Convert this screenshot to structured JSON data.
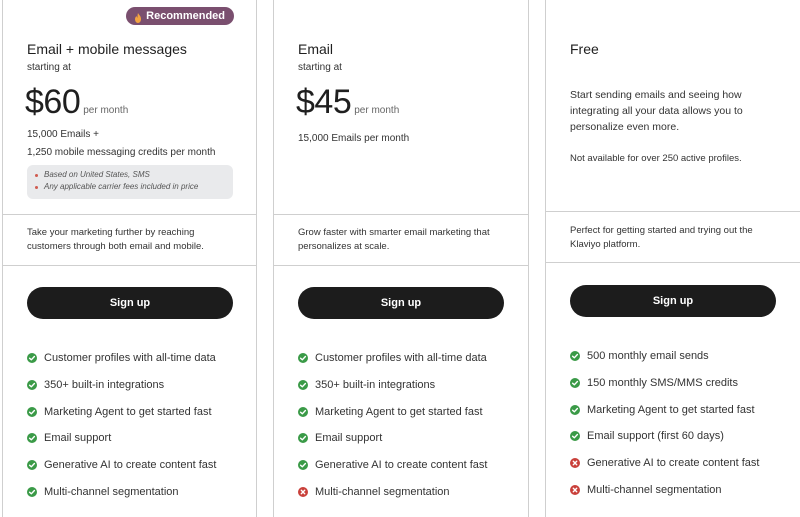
{
  "plans": [
    {
      "badge": "Recommended",
      "name": "Email + mobile messages",
      "starting": "starting at",
      "price": "$60",
      "per": "per month",
      "details": [
        "15,000 Emails +",
        "1,250 mobile messaging credits per month"
      ],
      "notes": [
        "Based on United States, SMS",
        "Any applicable carrier fees included in price"
      ],
      "desc": "Take your marketing further by reaching customers through both email and mobile.",
      "button": "Sign up",
      "features": [
        {
          "text": "Customer profiles with all-time data",
          "included": true
        },
        {
          "text": "350+ built-in integrations",
          "included": true
        },
        {
          "text": "Marketing Agent to get started fast",
          "included": true
        },
        {
          "text": "Email support",
          "included": true
        },
        {
          "text": "Generative AI to create content fast",
          "included": true
        },
        {
          "text": "Multi-channel segmentation",
          "included": true
        }
      ]
    },
    {
      "name": "Email",
      "starting": "starting at",
      "price": "$45",
      "per": "per month",
      "details": [
        "15,000 Emails per month"
      ],
      "desc": "Grow faster with smarter email marketing that personalizes at scale.",
      "button": "Sign up",
      "features": [
        {
          "text": "Customer profiles with all-time data",
          "included": true
        },
        {
          "text": "350+ built-in integrations",
          "included": true
        },
        {
          "text": "Marketing Agent to get started fast",
          "included": true
        },
        {
          "text": "Email support",
          "included": true
        },
        {
          "text": "Generative AI to create content fast",
          "included": true
        },
        {
          "text": "Multi-channel segmentation",
          "included": false
        }
      ]
    },
    {
      "name": "Free",
      "intro": "Start sending emails and seeing how integrating all your data allows you to personalize even more.",
      "limit": "Not available for over 250 active profiles.",
      "desc": "Perfect for getting started and trying out the Klaviyo platform.",
      "button": "Sign up",
      "features": [
        {
          "text": "500 monthly email sends",
          "included": true
        },
        {
          "text": "150 monthly SMS/MMS credits",
          "included": true
        },
        {
          "text": "Marketing Agent to get started fast",
          "included": true
        },
        {
          "text": "Email support (first 60 days)",
          "included": true
        },
        {
          "text": "Generative AI to create content fast",
          "included": false
        },
        {
          "text": "Multi-channel segmentation",
          "included": false
        }
      ]
    }
  ],
  "colors": {
    "badge": "#7a4f6f",
    "button": "#1c1c1c",
    "check": "#3a9a47",
    "cross": "#c9403a"
  }
}
